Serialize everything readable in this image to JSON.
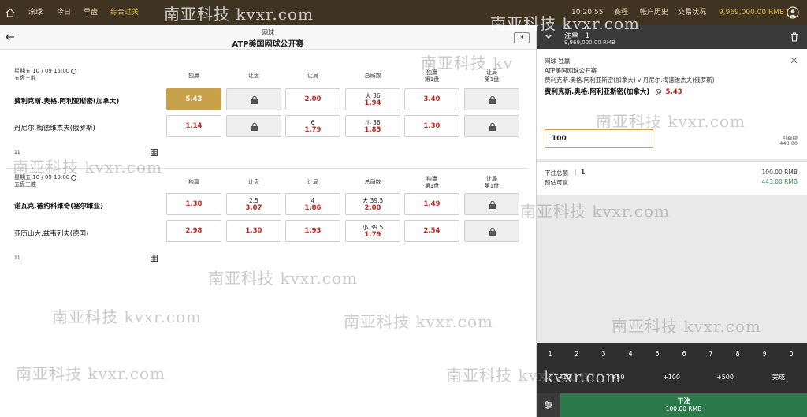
{
  "nav": {
    "items": [
      "滚球",
      "今日",
      "早盘",
      "综合过关"
    ],
    "time": "10:20:55",
    "links": [
      "赛程",
      "帐户历史",
      "交易状况"
    ],
    "balance": "9,969,000.00 RMB"
  },
  "header": {
    "sport": "网球",
    "league": "ATP美国网球公开赛",
    "count": "3"
  },
  "matches": [
    {
      "datetime": "星期五 10 / 09   15:00",
      "format": "五盘三胜",
      "columns": [
        "独赢",
        "让盘",
        "让局",
        "总局数",
        "独赢\n第1盘",
        "让局\n第1盘"
      ],
      "teams": [
        "费利克斯.奥格.阿利亚斯密(加拿大)",
        "丹尼尔.梅德维杰夫(俄罗斯)"
      ],
      "rows": [
        [
          {
            "v": "5.43",
            "selected": true
          },
          {
            "lock": true
          },
          {
            "v": "2.00"
          },
          {
            "l": "大 36",
            "v": "1.94"
          },
          {
            "v": "3.40"
          },
          {
            "lock": true
          }
        ],
        [
          {
            "v": "1.14"
          },
          {
            "lock": true
          },
          {
            "l": "6",
            "v": "1.79"
          },
          {
            "l": "小 36",
            "v": "1.85"
          },
          {
            "v": "1.30"
          },
          {
            "lock": true
          }
        ]
      ],
      "footer": "11"
    },
    {
      "datetime": "星期五 10 / 09   19:00",
      "format": "五盘三胜",
      "columns": [
        "独赢",
        "让盘",
        "让局",
        "总局数",
        "独赢\n第1盘",
        "让局\n第1盘"
      ],
      "teams": [
        "诺瓦克.德约科维奇(塞尔维亚)",
        "亚历山大.兹韦列夫(德国)"
      ],
      "rows": [
        [
          {
            "v": "1.38"
          },
          {
            "l": "2.5",
            "v": "3.07"
          },
          {
            "l": "4",
            "v": "1.86"
          },
          {
            "l": "大 39.5",
            "v": "2.00"
          },
          {
            "v": "1.49"
          },
          {
            "lock": true
          }
        ],
        [
          {
            "v": "2.98"
          },
          {
            "v": "1.30"
          },
          {
            "v": "1.93"
          },
          {
            "l": "小 39.5",
            "v": "1.79"
          },
          {
            "v": "2.54"
          },
          {
            "lock": true
          }
        ]
      ],
      "footer": "11"
    }
  ],
  "betslip": {
    "title": "注单",
    "count": "1",
    "balance": "9,969,000.00 RMB",
    "market": "网球 独赢",
    "league": "ATP美国网球公开赛",
    "fixture": "费利克斯.奥格.阿利亚斯密(加拿大) v 丹尼尔.梅德维杰夫(俄罗斯)",
    "selection": "费利克斯.奥格.阿利亚斯密(加拿大)",
    "at": "@",
    "odds": "5.43",
    "stake": "100",
    "payout_label": "可赢额",
    "payout_value": "443.00",
    "total_label": "下注总额",
    "total_count": "1",
    "total_value": "100.00 RMB",
    "est_label": "预估可赢",
    "est_value": "443.00 RMB",
    "keys": [
      "1",
      "2",
      "3",
      "4",
      "5",
      "6",
      "7",
      "8",
      "9",
      "0"
    ],
    "quick": [
      "+10",
      "+50",
      "+100",
      "+500",
      "完成"
    ],
    "place_label": "下注",
    "place_amount": "100.00 RMB"
  },
  "watermarks": [
    "南亚科技 kvxr.com",
    "南亚科技 kvxr.com",
    "南亚科技 kv",
    "南亚科技 kvxr.com",
    "南亚科技 kvxr.com",
    "南亚科技 kvxr.com",
    "南亚科技 kvxr.com",
    "南亚科技 kvxr.com",
    "南亚科技 kvxr.com",
    "南亚科技 kvxr.com",
    "南亚科技 kvxr.com",
    "南亚科技 kvxr.com",
    "kvxr.com",
    "南亚科技 kvxr.com"
  ],
  "colors": {
    "topbar": "#3f3322",
    "accent": "#c9a04a",
    "odds": "#c2271f",
    "place": "#2c7a4b",
    "payout": "#2c8a4b"
  }
}
